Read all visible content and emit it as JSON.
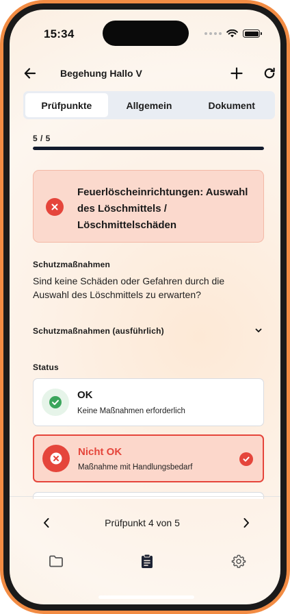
{
  "status_bar": {
    "time": "15:34"
  },
  "header": {
    "title": "Begehung Hallo V"
  },
  "tabs": [
    {
      "label": "Prüfpunkte",
      "active": true
    },
    {
      "label": "Allgemein",
      "active": false
    },
    {
      "label": "Dokument",
      "active": false
    }
  ],
  "progress": {
    "text": "5 / 5",
    "fraction": 1.0
  },
  "alert": {
    "title": "Feuerlöscheinrichtungen: Auswahl des Löschmittels / Löschmittelschäden"
  },
  "question": {
    "section_label": "Schutzmaßnahmen",
    "text": "Sind keine Schäden oder Gefahren durch die Auswahl des Löschmittels zu erwarten?"
  },
  "accordion": {
    "label": "Schutzmaßnahmen (ausführlich)"
  },
  "status": {
    "label": "Status",
    "options": [
      {
        "title": "OK",
        "description": "Keine Maßnahmen erforderlich",
        "selected": false
      },
      {
        "title": "Nicht OK",
        "description": "Maßnahme mit Handlungsbedarf",
        "selected": true
      }
    ]
  },
  "pager": {
    "label": "Prüfpunkt 4 von 5"
  },
  "colors": {
    "accent_frame": "#f28c44",
    "error_red": "#e5453b",
    "error_bg": "#fbd9cd",
    "ok_green": "#3ba55c",
    "progress_dark": "#121a2c"
  },
  "icons": {
    "back": "arrow-left-icon",
    "add": "plus-icon",
    "refresh": "refresh-icon",
    "alert": "x-circle-icon",
    "chevron": "chevron-down-icon",
    "prev": "chevron-left-icon",
    "next": "chevron-right-icon",
    "folder": "folder-icon",
    "clipboard": "clipboard-icon",
    "settings": "gear-icon"
  }
}
